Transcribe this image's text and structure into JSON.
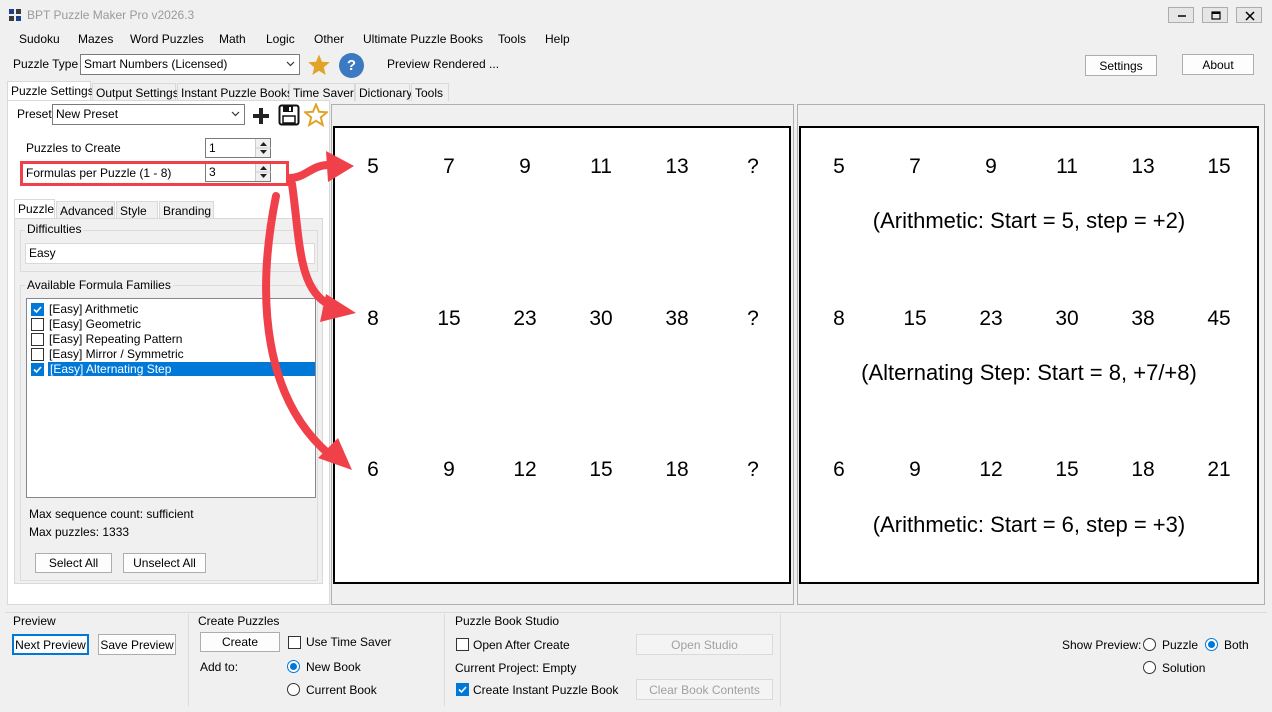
{
  "window": {
    "title": "BPT Puzzle Maker Pro v2026.3"
  },
  "menu": [
    "Sudoku",
    "Mazes",
    "Word Puzzles",
    "Math",
    "Logic",
    "Other",
    "Ultimate Puzzle Books",
    "Tools",
    "Help"
  ],
  "toolbar": {
    "puzzle_type_label": "Puzzle Type",
    "puzzle_type_value": "Smart Numbers (Licensed)",
    "status": "Preview Rendered ...",
    "settings_label": "Settings",
    "about_label": "About",
    "help_glyph": "?"
  },
  "main_tabs": [
    "Puzzle Settings",
    "Output Settings",
    "Instant Puzzle Books",
    "Time Saver",
    "Dictionary",
    "Tools"
  ],
  "settings": {
    "preset_label": "Preset",
    "preset_value": "New Preset",
    "puzzles_to_create_label": "Puzzles to Create",
    "puzzles_to_create_value": "1",
    "formulas_label": "Formulas per Puzzle (1 - 8)",
    "formulas_value": "3",
    "sub_tabs": [
      "Puzzle",
      "Advanced",
      "Style",
      "Branding"
    ],
    "difficulties_label": "Difficulties",
    "difficulty_value": "Easy",
    "families_label": "Available Formula Families",
    "families": [
      {
        "label": "[Easy] Arithmetic",
        "checked": true
      },
      {
        "label": "[Easy] Geometric",
        "checked": false
      },
      {
        "label": "[Easy] Repeating Pattern",
        "checked": false
      },
      {
        "label": "[Easy] Mirror / Symmetric",
        "checked": false
      },
      {
        "label": "[Easy] Alternating Step",
        "checked": true
      }
    ],
    "max_sequence": "Max sequence count: sufficient",
    "max_puzzles": "Max puzzles: 1333",
    "select_all_label": "Select All",
    "unselect_all_label": "Unselect All"
  },
  "puzzle_preview": {
    "rows": [
      [
        "5",
        "7",
        "9",
        "11",
        "13",
        "?"
      ],
      [
        "8",
        "15",
        "23",
        "30",
        "38",
        "?"
      ],
      [
        "6",
        "9",
        "12",
        "15",
        "18",
        "?"
      ]
    ]
  },
  "solution_preview": {
    "rows": [
      {
        "values": [
          "5",
          "7",
          "9",
          "11",
          "13",
          "15"
        ],
        "formula": "(Arithmetic: Start = 5, step = +2)"
      },
      {
        "values": [
          "8",
          "15",
          "23",
          "30",
          "38",
          "45"
        ],
        "formula": "(Alternating Step: Start = 8, +7/+8)"
      },
      {
        "values": [
          "6",
          "9",
          "12",
          "15",
          "18",
          "21"
        ],
        "formula": "(Arithmetic: Start = 6, step = +3)"
      }
    ]
  },
  "bottom": {
    "preview_label": "Preview",
    "next_preview_label": "Next Preview",
    "save_preview_label": "Save Preview",
    "create_puzzles_label": "Create Puzzles",
    "create_label": "Create",
    "use_time_saver_label": "Use Time Saver",
    "add_to_label": "Add to:",
    "new_book_label": "New Book",
    "current_book_label": "Current Book",
    "studio_label": "Puzzle Book Studio",
    "open_after_create_label": "Open After Create",
    "open_studio_label": "Open Studio",
    "current_project_label": "Current Project: Empty",
    "create_instant_label": "Create Instant Puzzle Book",
    "clear_book_label": "Clear Book Contents",
    "show_preview_label": "Show Preview:",
    "show_puzzle_label": "Puzzle",
    "show_both_label": "Both",
    "show_solution_label": "Solution"
  },
  "colors": {
    "accent": "#0078d7",
    "annotation_red": "#f0414a",
    "star": "#e0a526",
    "help_circle": "#3b79c0"
  }
}
